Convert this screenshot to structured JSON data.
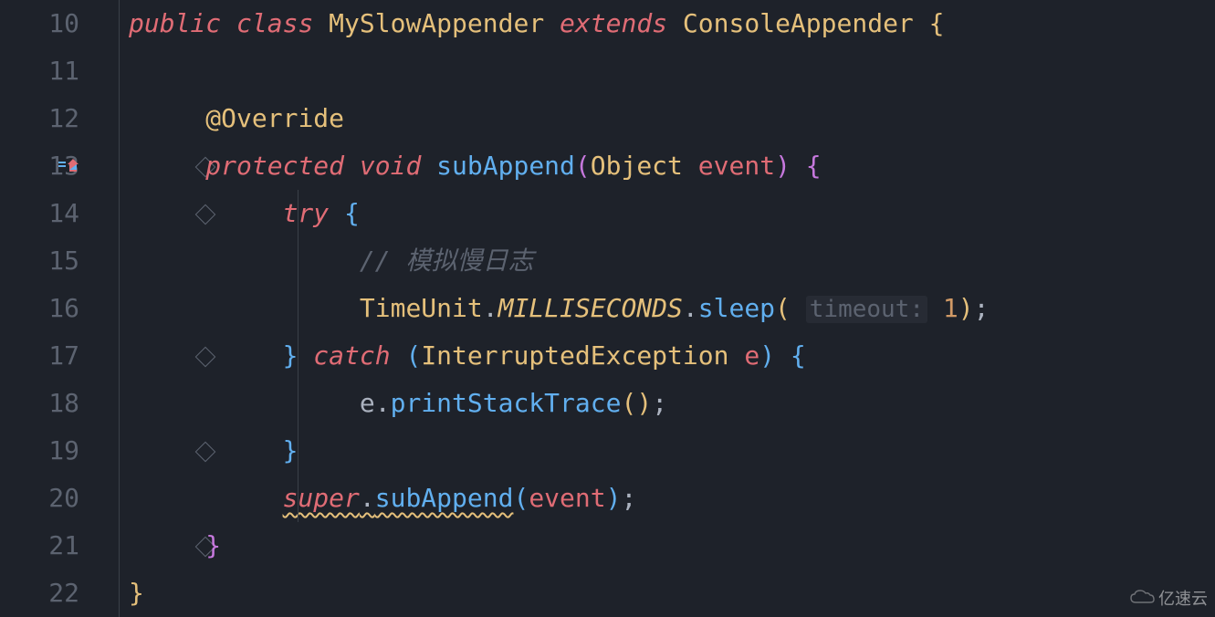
{
  "lineNumbers": [
    "10",
    "11",
    "12",
    "13",
    "14",
    "15",
    "16",
    "17",
    "18",
    "19",
    "20",
    "21",
    "22"
  ],
  "code": {
    "l10": {
      "kw1": "public",
      "kw2": "class",
      "cls": "MySlowAppender",
      "kw3": "extends",
      "sup": "ConsoleAppender",
      "ob": "{"
    },
    "l12": {
      "ann": "@Override"
    },
    "l13": {
      "kw1": "protected",
      "kw2": "void",
      "m": "subAppend",
      "po": "(",
      "pt": "Object",
      "pn": "event",
      "pc": ")",
      "ob": "{"
    },
    "l14": {
      "kw": "try",
      "ob": "{"
    },
    "l15": {
      "c": "// 模拟慢日志"
    },
    "l16": {
      "t": "TimeUnit",
      "d1": ".",
      "f": "MILLISECONDS",
      "d2": ".",
      "m": "sleep",
      "po": "(",
      "hint": "timeout:",
      "n": "1",
      "pc": ")",
      "s": ";"
    },
    "l17": {
      "cb": "}",
      "kw": "catch",
      "po": "(",
      "t": "InterruptedException",
      "pn": "e",
      "pc": ")",
      "ob": "{"
    },
    "l18": {
      "v": "e",
      "d": ".",
      "m": "printStackTrace",
      "po": "(",
      "pc": ")",
      "s": ";"
    },
    "l19": {
      "cb": "}"
    },
    "l20": {
      "s": "super",
      "d": ".",
      "m": "subAppend",
      "po": "(",
      "a": "event",
      "pc": ")",
      "sc": ";"
    },
    "l21": {
      "cb": "}"
    },
    "l22": {
      "cb": "}"
    }
  },
  "watermark": "亿速云"
}
